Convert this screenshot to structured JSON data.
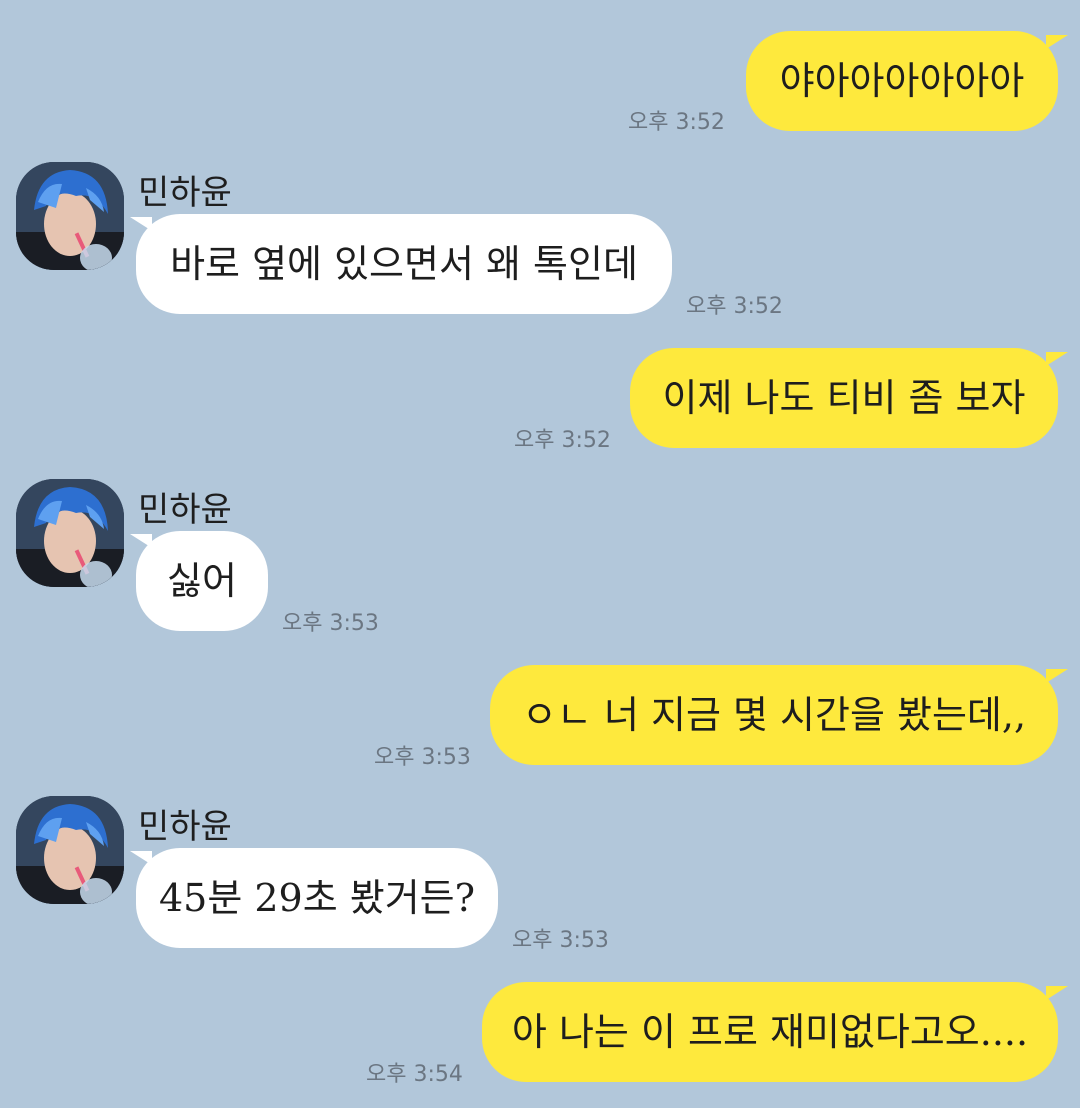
{
  "contact": {
    "name": "민하윤"
  },
  "messages": [
    {
      "sender": "me",
      "text": "야아아아아아아",
      "time": "오후 3:52"
    },
    {
      "sender": "other",
      "text": "바로 옆에 있으면서 왜 톡인데",
      "time": "오후 3:52"
    },
    {
      "sender": "me",
      "text": "이제 나도 티비 좀 보자",
      "time": "오후 3:52"
    },
    {
      "sender": "other",
      "text": "싫어",
      "time": "오후 3:53"
    },
    {
      "sender": "me",
      "text": "ㅇㄴ 너 지금 몇 시간을 봤는데,,",
      "time": "오후 3:53"
    },
    {
      "sender": "other",
      "text": "45분 29초 봤거든?",
      "time": "오후 3:53"
    },
    {
      "sender": "me",
      "text": "아 나는 이 프로 재미없다고오....",
      "time": "오후 3:54"
    }
  ],
  "colors": {
    "background": "#b2c7da",
    "my_bubble": "#fee93d",
    "their_bubble": "#ffffff",
    "timestamp": "#6b7682"
  },
  "icons": {
    "avatar": "profile-photo-blue-hair"
  }
}
